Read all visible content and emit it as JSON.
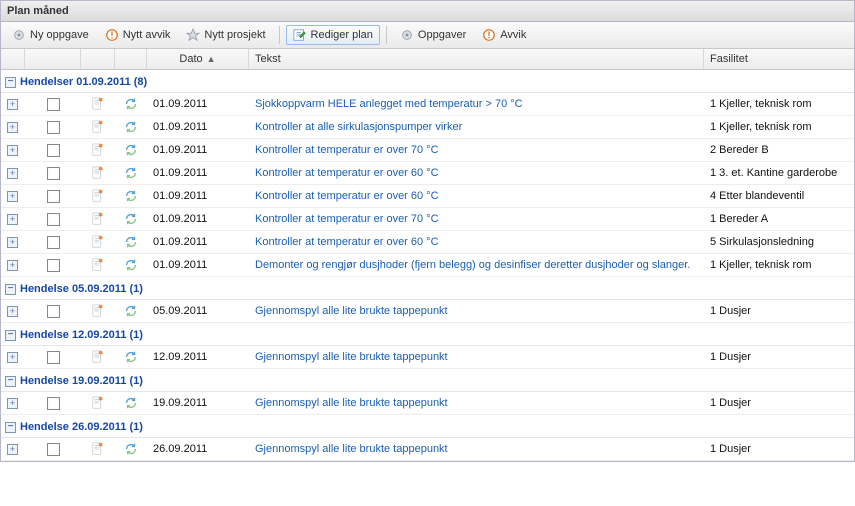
{
  "panel": {
    "title": "Plan måned"
  },
  "toolbar": {
    "new_task": "Ny oppgave",
    "new_deviation": "Nytt avvik",
    "new_project": "Nytt prosjekt",
    "edit_plan": "Rediger plan",
    "tasks": "Oppgaver",
    "deviations": "Avvik"
  },
  "columns": {
    "date": "Dato",
    "text": "Tekst",
    "facility": "Fasilitet"
  },
  "groups": [
    {
      "title": "Hendelser 01.09.2011 (8)",
      "rows": [
        {
          "date": "01.09.2011",
          "text": "Sjokkoppvarm HELE anlegget med temperatur > 70 °C",
          "facility": "1 Kjeller, teknisk rom"
        },
        {
          "date": "01.09.2011",
          "text": "Kontroller at alle sirkulasjonspumper virker",
          "facility": "1 Kjeller, teknisk rom"
        },
        {
          "date": "01.09.2011",
          "text": "Kontroller at temperatur er over 70 °C",
          "facility": "2 Bereder B"
        },
        {
          "date": "01.09.2011",
          "text": "Kontroller at temperatur er over 60 °C",
          "facility": "1 3. et. Kantine garderobe"
        },
        {
          "date": "01.09.2011",
          "text": "Kontroller at temperatur er over 60 °C",
          "facility": "4 Etter blandeventil"
        },
        {
          "date": "01.09.2011",
          "text": "Kontroller at temperatur er over 70 °C",
          "facility": "1 Bereder A"
        },
        {
          "date": "01.09.2011",
          "text": "Kontroller at temperatur er over 60 °C",
          "facility": "5 Sirkulasjonsledning"
        },
        {
          "date": "01.09.2011",
          "text": "Demonter og rengjør dusjhoder (fjern belegg) og desinfiser deretter dusjhoder og slanger.",
          "facility": "1 Kjeller, teknisk rom"
        }
      ]
    },
    {
      "title": "Hendelse 05.09.2011 (1)",
      "rows": [
        {
          "date": "05.09.2011",
          "text": "Gjennomspyl alle lite brukte tappepunkt",
          "facility": "1 Dusjer"
        }
      ]
    },
    {
      "title": "Hendelse 12.09.2011 (1)",
      "rows": [
        {
          "date": "12.09.2011",
          "text": "Gjennomspyl alle lite brukte tappepunkt",
          "facility": "1 Dusjer"
        }
      ]
    },
    {
      "title": "Hendelse 19.09.2011 (1)",
      "rows": [
        {
          "date": "19.09.2011",
          "text": "Gjennomspyl alle lite brukte tappepunkt",
          "facility": "1 Dusjer"
        }
      ]
    },
    {
      "title": "Hendelse 26.09.2011 (1)",
      "rows": [
        {
          "date": "26.09.2011",
          "text": "Gjennomspyl alle lite brukte tappepunkt",
          "facility": "1 Dusjer"
        }
      ]
    }
  ]
}
